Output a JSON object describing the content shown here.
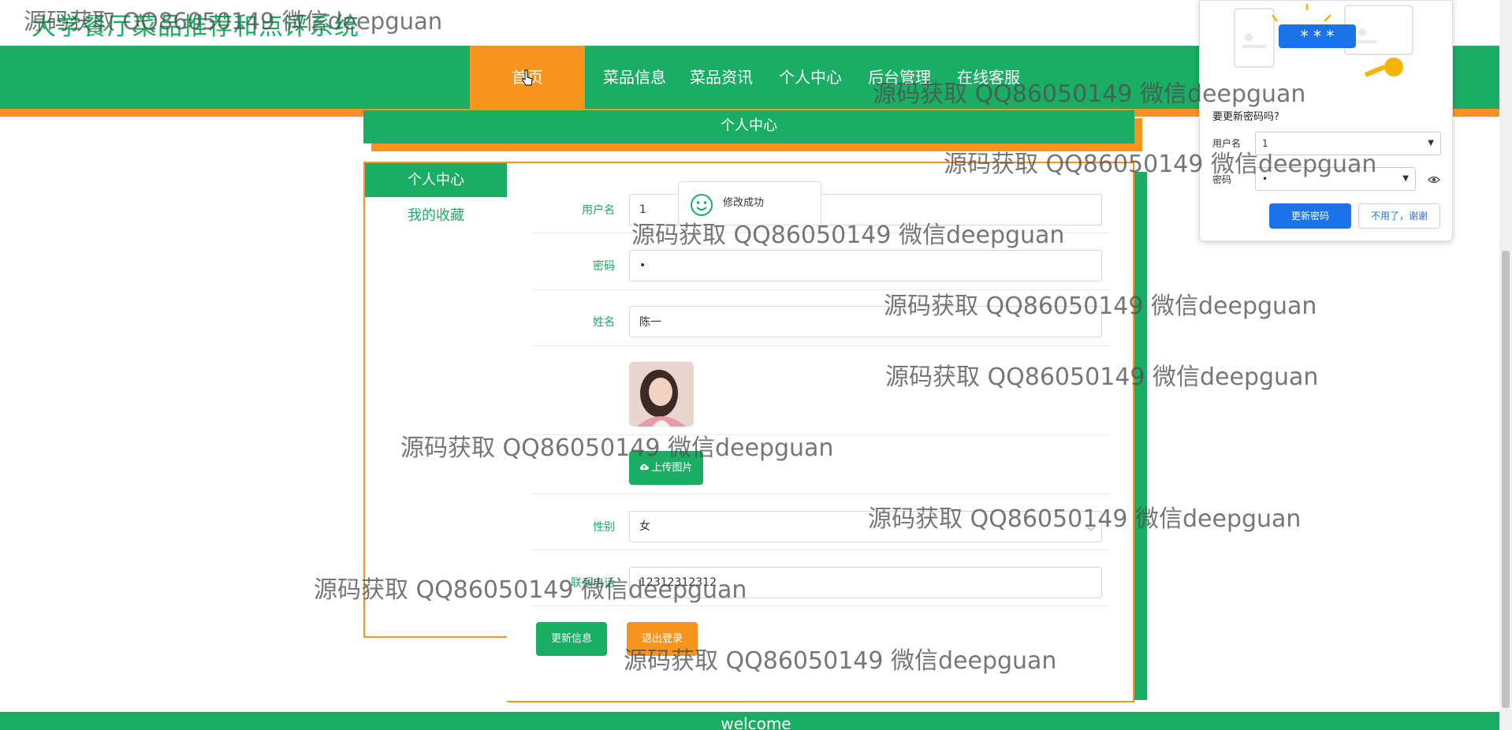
{
  "site": {
    "title": "大学餐厅菜品推荐和点评系统"
  },
  "nav": {
    "items": [
      {
        "label": "首页",
        "active": true
      },
      {
        "label": "菜品信息"
      },
      {
        "label": "菜品资讯"
      },
      {
        "label": "个人中心"
      },
      {
        "label": "后台管理"
      },
      {
        "label": "在线客服"
      }
    ]
  },
  "section": {
    "title": "个人中心"
  },
  "side_menu": {
    "active_label": "个人中心",
    "items": [
      {
        "label": "我的收藏"
      }
    ]
  },
  "form": {
    "username": {
      "label": "用户名",
      "value": "1"
    },
    "password": {
      "label": "密码",
      "value": "•"
    },
    "name": {
      "label": "姓名",
      "value": "陈一"
    },
    "upload_label": "上传图片",
    "gender": {
      "label": "性别",
      "value": "女"
    },
    "phone": {
      "label": "联系电话",
      "value": "12312312312"
    },
    "update_button": "更新信息",
    "logout_button": "退出登录"
  },
  "toast": {
    "text": "修改成功"
  },
  "footer": {
    "text": "welcome"
  },
  "password_prompt": {
    "question": "要更新密码吗?",
    "username_label": "用户名",
    "username_value": "1",
    "password_label": "密码",
    "password_value": "•",
    "mask_text": "* * *",
    "update_button": "更新密码",
    "dismiss_button": "不用了，谢谢"
  },
  "watermark": "源码获取 QQ86050149 微信deepguan",
  "colors": {
    "primary": "#1aad64",
    "accent": "#f7941d",
    "chrome_blue": "#1a73e8"
  }
}
